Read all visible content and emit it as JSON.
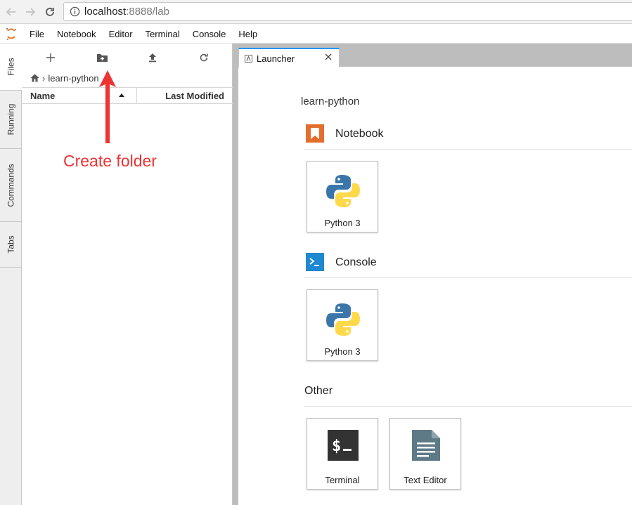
{
  "browser": {
    "url_host": "localhost",
    "url_rest": ":8888/lab"
  },
  "menu": {
    "items": [
      "File",
      "Notebook",
      "Editor",
      "Terminal",
      "Console",
      "Help"
    ]
  },
  "sidebar": {
    "tabs": [
      "Files",
      "Running",
      "Commands",
      "Tabs"
    ]
  },
  "file_browser": {
    "breadcrumb": "learn-python",
    "columns": {
      "name": "Name",
      "modified": "Last Modified"
    }
  },
  "annotation": {
    "text": "Create folder",
    "color": "#ee3333"
  },
  "launcher": {
    "tab_label": "Launcher",
    "cwd": "learn-python",
    "sections": {
      "notebook": {
        "title": "Notebook",
        "cards": [
          "Python 3"
        ]
      },
      "console": {
        "title": "Console",
        "cards": [
          "Python 3"
        ]
      },
      "other": {
        "title": "Other",
        "cards": [
          "Terminal",
          "Text Editor"
        ]
      }
    }
  },
  "colors": {
    "accent": "#2196f3",
    "notebook_orange": "#e46e2e",
    "console_blue": "#1e88d0",
    "text_editor_slate": "#5f7a87"
  }
}
